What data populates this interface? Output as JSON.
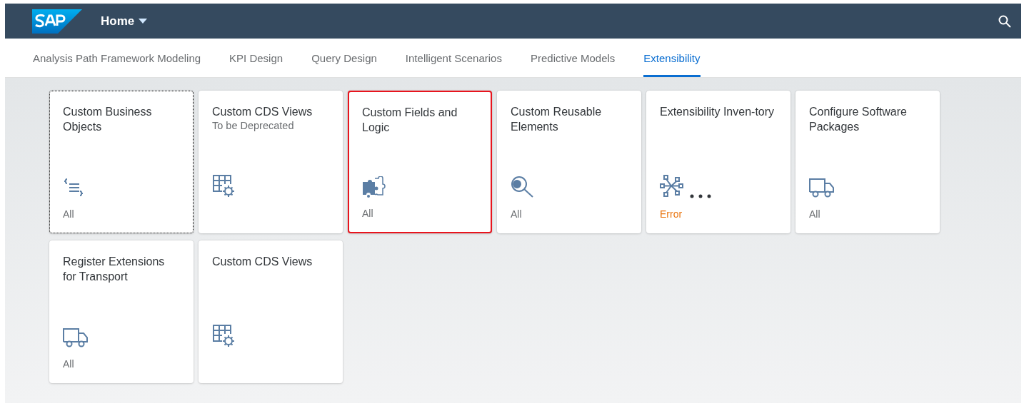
{
  "header": {
    "title": "Home"
  },
  "tabs": [
    {
      "label": "Analysis Path Framework Modeling",
      "selected": false
    },
    {
      "label": "KPI Design",
      "selected": false
    },
    {
      "label": "Query Design",
      "selected": false
    },
    {
      "label": "Intelligent Scenarios",
      "selected": false
    },
    {
      "label": "Predictive Models",
      "selected": false
    },
    {
      "label": "Extensibility",
      "selected": true
    }
  ],
  "tiles": [
    {
      "title": "Custom Business Objects",
      "footer": "All",
      "error": false,
      "focused": true,
      "highlighted": false,
      "busy": false
    },
    {
      "title": "Custom CDS Views",
      "subtitle": "To be Deprecated",
      "focused": false,
      "highlighted": false,
      "busy": false
    },
    {
      "title": "Custom Fields and Logic",
      "footer": "All",
      "error": false,
      "focused": false,
      "highlighted": true,
      "busy": false
    },
    {
      "title": "Custom Reusable Elements",
      "footer": "All",
      "error": false,
      "focused": false,
      "highlighted": false,
      "busy": false
    },
    {
      "title": "Extensibility Inven-tory",
      "footer": "Error",
      "error": true,
      "focused": false,
      "highlighted": false,
      "busy": true
    },
    {
      "title": "Configure Software Packages",
      "footer": "All",
      "error": false,
      "focused": false,
      "highlighted": false,
      "busy": false
    },
    {
      "title": "Register Extensions for Transport",
      "footer": "All",
      "error": false,
      "focused": false,
      "highlighted": false,
      "busy": false
    },
    {
      "title": "Custom CDS Views",
      "focused": false,
      "highlighted": false,
      "busy": false
    }
  ]
}
